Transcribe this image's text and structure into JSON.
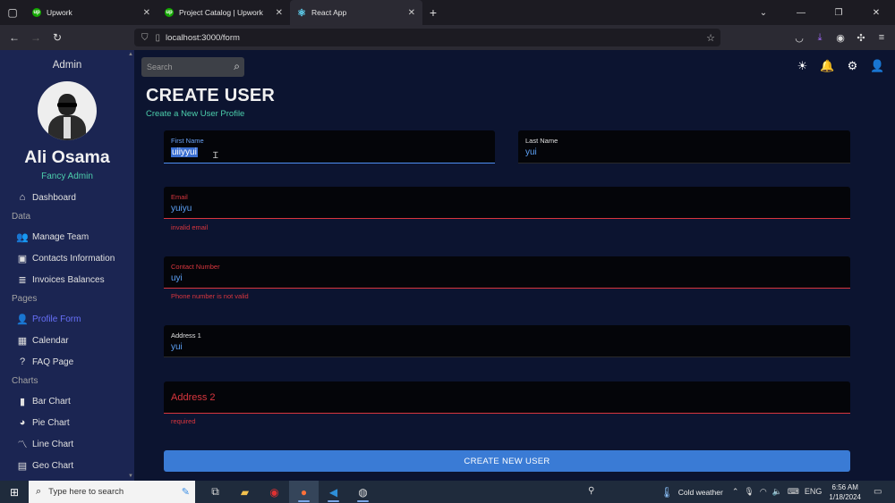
{
  "browser": {
    "tabs": [
      {
        "title": "Upwork",
        "active": false
      },
      {
        "title": "Project Catalog | Upwork",
        "active": false
      },
      {
        "title": "React App",
        "active": true
      }
    ],
    "url": "localhost:3000/form"
  },
  "sidebar": {
    "admin_label": "Admin",
    "user_name": "Ali Osama",
    "user_role": "Fancy Admin",
    "items": [
      {
        "type": "item",
        "label": "Dashboard",
        "icon": "home-icon",
        "glyph": "⌂",
        "active": false
      },
      {
        "type": "section",
        "label": "Data"
      },
      {
        "type": "item",
        "label": "Manage Team",
        "icon": "people-icon",
        "glyph": "👥",
        "active": false
      },
      {
        "type": "item",
        "label": "Contacts Information",
        "icon": "contacts-icon",
        "glyph": "▣",
        "active": false
      },
      {
        "type": "item",
        "label": "Invoices Balances",
        "icon": "receipt-icon",
        "glyph": "≣",
        "active": false
      },
      {
        "type": "section",
        "label": "Pages"
      },
      {
        "type": "item",
        "label": "Profile Form",
        "icon": "person-icon",
        "glyph": "👤",
        "active": true
      },
      {
        "type": "item",
        "label": "Calendar",
        "icon": "calendar-icon",
        "glyph": "▦",
        "active": false
      },
      {
        "type": "item",
        "label": "FAQ Page",
        "icon": "help-icon",
        "glyph": "?",
        "active": false
      },
      {
        "type": "section",
        "label": "Charts"
      },
      {
        "type": "item",
        "label": "Bar Chart",
        "icon": "bar-chart-icon",
        "glyph": "▮",
        "active": false
      },
      {
        "type": "item",
        "label": "Pie Chart",
        "icon": "pie-chart-icon",
        "glyph": "◕",
        "active": false
      },
      {
        "type": "item",
        "label": "Line Chart",
        "icon": "line-chart-icon",
        "glyph": "〽",
        "active": false
      },
      {
        "type": "item",
        "label": "Geo Chart",
        "icon": "map-icon",
        "glyph": "▤",
        "active": false
      }
    ]
  },
  "topbar": {
    "search_placeholder": "Search"
  },
  "page": {
    "title": "CREATE USER",
    "subtitle": "Create a New User Profile"
  },
  "form": {
    "first_name": {
      "label": "First Name",
      "value": "uiiyyui"
    },
    "last_name": {
      "label": "Last Name",
      "value": "yui"
    },
    "email": {
      "label": "Email",
      "value": "yuiyu",
      "error": "invalid email"
    },
    "contact": {
      "label": "Contact Number",
      "value": "uyi",
      "error": "Phone number is not valid"
    },
    "address1": {
      "label": "Address 1",
      "value": "yui"
    },
    "address2": {
      "label": "Address 2",
      "value": "",
      "error": "required"
    },
    "submit_label": "CREATE NEW USER"
  },
  "taskbar": {
    "search_placeholder": "Type here to search",
    "weather": "Cold weather",
    "language": "ENG",
    "time": "6:56 AM",
    "date": "1/18/2024"
  },
  "colors": {
    "accent_green": "#4cceac",
    "error_red": "#d9363e",
    "primary_blue": "#3a7bd5",
    "active_nav": "#6870fa"
  }
}
